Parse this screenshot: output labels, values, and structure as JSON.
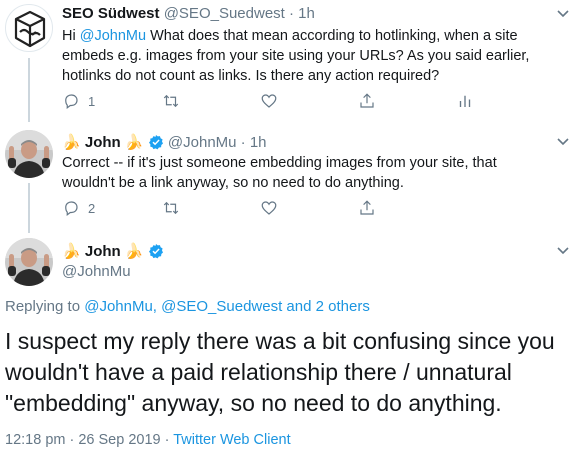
{
  "tweet1": {
    "display_name": "SEO Südwest",
    "handle": "@SEO_Suedwest",
    "separator": "·",
    "time": "1h",
    "text_prefix": "Hi ",
    "mention": "@JohnMu",
    "text_rest": " What does that mean according to hotlinking, when a site embeds e.g. images from your site using your URLs? As you said earlier, hotlinks do not count as links. Is there any action required?",
    "reply_count": "1"
  },
  "tweet2": {
    "display_name": "John",
    "emoji": "🍌",
    "handle": "@JohnMu",
    "separator": "·",
    "time": "1h",
    "text": "Correct -- if it's just someone embedding images from your site, that wouldn't be a link anyway, so no need to do anything.",
    "reply_count": "2"
  },
  "main_tweet": {
    "display_name": "John",
    "emoji": "🍌",
    "handle": "@JohnMu",
    "replying_prefix": "Replying to ",
    "replying_to": "@JohnMu, @SEO_Suedwest and 2 others",
    "text": "I suspect my reply there was a bit confusing since you wouldn't have a paid relationship there / unnatural \"embedding\" anyway, so no need to do anything.",
    "timestamp": "12:18 pm · 26 Sep 2019",
    "meta_separator": " · ",
    "client": "Twitter Web Client"
  },
  "icons": {
    "reply": "reply-icon",
    "retweet": "retweet-icon",
    "like": "heart-icon",
    "share": "share-icon",
    "analytics": "analytics-icon",
    "verified": "verified-badge-icon",
    "chevron": "chevron-down-icon"
  },
  "colors": {
    "link": "#1b95e0",
    "secondary": "#657786",
    "verified": "#1da1f2",
    "thread_line": "#ccd6dd"
  }
}
